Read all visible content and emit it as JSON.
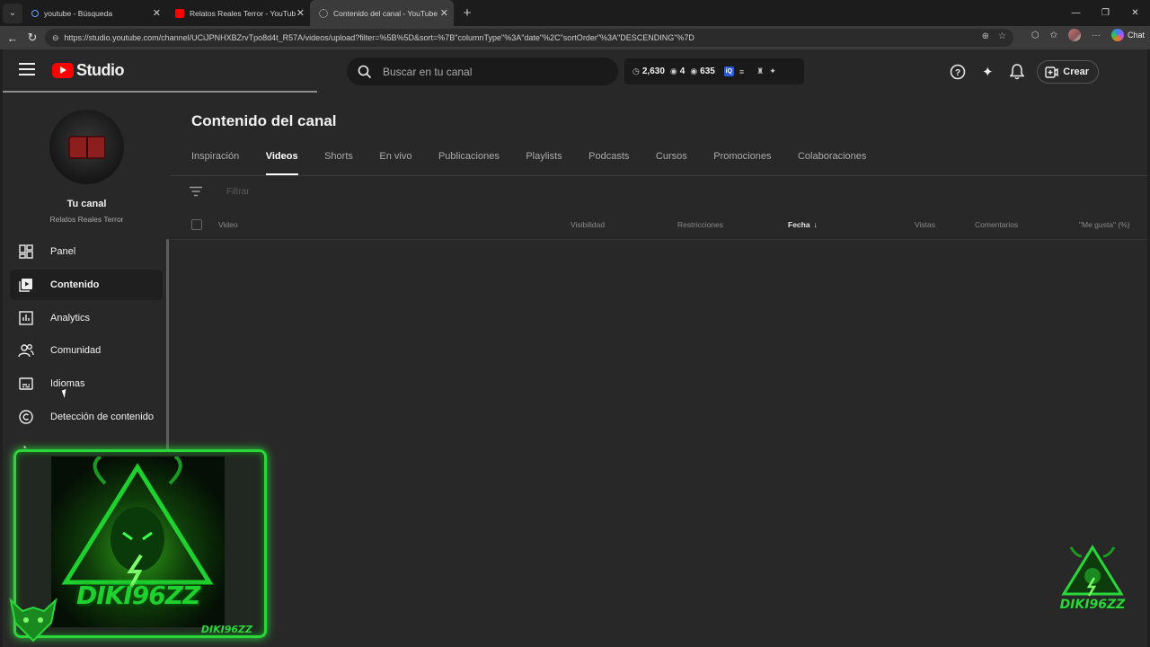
{
  "browser": {
    "tabs": [
      {
        "title": "youtube - Búsqueda",
        "active": false
      },
      {
        "title": "Relatos Reales Terror - YouTube",
        "active": false
      },
      {
        "title": "Contenido del canal - YouTube Studio",
        "active": true
      }
    ],
    "url": "https://studio.youtube.com/channel/UCiJPNHXBZrvTpo8d4t_R57A/videos/upload?filter=%5B%5D&sort=%7B\"columnType\"%3A\"date\"%2C\"sortOrder\"%3A\"DESCENDING\"%7D",
    "chat_label": "Chat"
  },
  "header": {
    "logo_text": "Studio",
    "search_placeholder": "Buscar en tu canal",
    "stats": {
      "watch": "2,630",
      "subs": "4",
      "views": "635"
    },
    "create_label": "Crear"
  },
  "sidebar": {
    "channel_title": "Tu canal",
    "channel_name": "Relatos Reales Terror",
    "items": [
      {
        "label": "Panel",
        "icon": "dashboard-icon",
        "active": false
      },
      {
        "label": "Contenido",
        "icon": "content-icon",
        "active": true
      },
      {
        "label": "Analytics",
        "icon": "analytics-icon",
        "active": false
      },
      {
        "label": "Comunidad",
        "icon": "community-icon",
        "active": false
      },
      {
        "label": "Idiomas",
        "icon": "subtitles-icon",
        "active": false
      },
      {
        "label": "Detección de contenido",
        "icon": "copyright-icon",
        "active": false
      }
    ]
  },
  "main": {
    "title": "Contenido del canal",
    "tabs": [
      "Inspiración",
      "Videos",
      "Shorts",
      "En vivo",
      "Publicaciones",
      "Playlists",
      "Podcasts",
      "Cursos",
      "Promociones",
      "Colaboraciones"
    ],
    "active_tab": "Videos",
    "filter_placeholder": "Filtrar",
    "columns": {
      "video": "Video",
      "visibility": "Visibilidad",
      "restrictions": "Restricciones",
      "date": "Fecha",
      "views": "Vistas",
      "comments": "Comentarios",
      "likes": "\"Me gusta\" (%)"
    }
  },
  "overlay": {
    "logo_text": "DIKI96ZZ",
    "tag_text": "DIKI96ZZ",
    "watermark_text": "DIKI96ZZ"
  },
  "colors": {
    "accent_green": "#2bd63a",
    "yt_red": "#ff0000"
  }
}
